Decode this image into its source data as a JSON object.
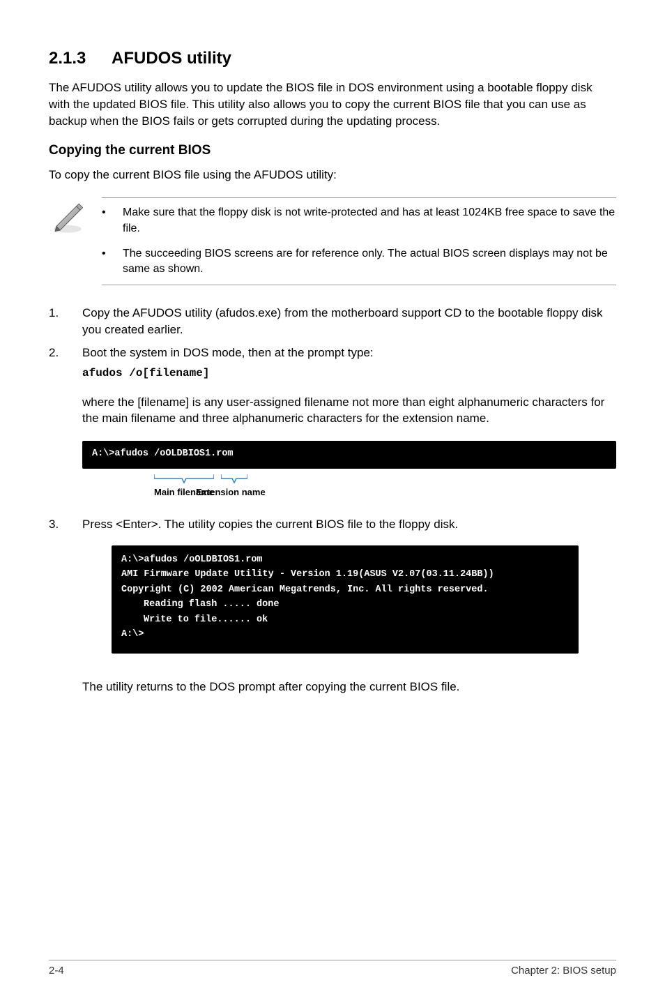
{
  "section_number": "2.1.3",
  "section_title": "AFUDOS utility",
  "intro_paragraph": "The AFUDOS utility allows you to update the BIOS file in DOS environment using a bootable floppy disk with the updated BIOS file. This utility also allows you to copy the current BIOS file that you can use as backup when the BIOS fails or gets corrupted during the updating process.",
  "subheading": "Copying the current BIOS",
  "sub_intro": "To copy the current BIOS file using the AFUDOS utility:",
  "note_bullet": "•",
  "notes": {
    "item1": "Make sure that the floppy disk is not write-protected and has at least 1024KB free space to save the file.",
    "item2": "The succeeding BIOS screens are for reference only. The actual BIOS screen displays may not be same as shown."
  },
  "steps": {
    "s1_num": "1.",
    "s1_text": "Copy the AFUDOS utility (afudos.exe) from the motherboard support CD to the bootable floppy disk you created earlier.",
    "s2_num": "2.",
    "s2_text": "Boot the system in DOS mode, then at the prompt type:",
    "s2_code": "afudos /o[filename]",
    "s2_after": "where the [filename] is any user-assigned filename not more than eight alphanumeric characters  for the main filename and three alphanumeric characters for the extension name.",
    "s3_num": "3.",
    "s3_text": "Press <Enter>. The utility copies the current BIOS file to the floppy disk."
  },
  "terminal1": {
    "line1": "A:\\>afudos /oOLDBIOS1.rom"
  },
  "diagram": {
    "main_label": "Main filename",
    "ext_label": "Extension name"
  },
  "terminal2": {
    "l1": "A:\\>afudos /oOLDBIOS1.rom",
    "l2": "AMI Firmware Update Utility - Version 1.19(ASUS V2.07(03.11.24BB))",
    "l3": "Copyright (C) 2002 American Megatrends, Inc. All rights reserved.",
    "l4": "Reading flash ..... done",
    "l5": "Write to file...... ok",
    "l6": "A:\\>"
  },
  "closing": "The utility returns to the DOS prompt after copying the current BIOS file.",
  "footer": {
    "left": "2-4",
    "right": "Chapter 2: BIOS setup"
  }
}
